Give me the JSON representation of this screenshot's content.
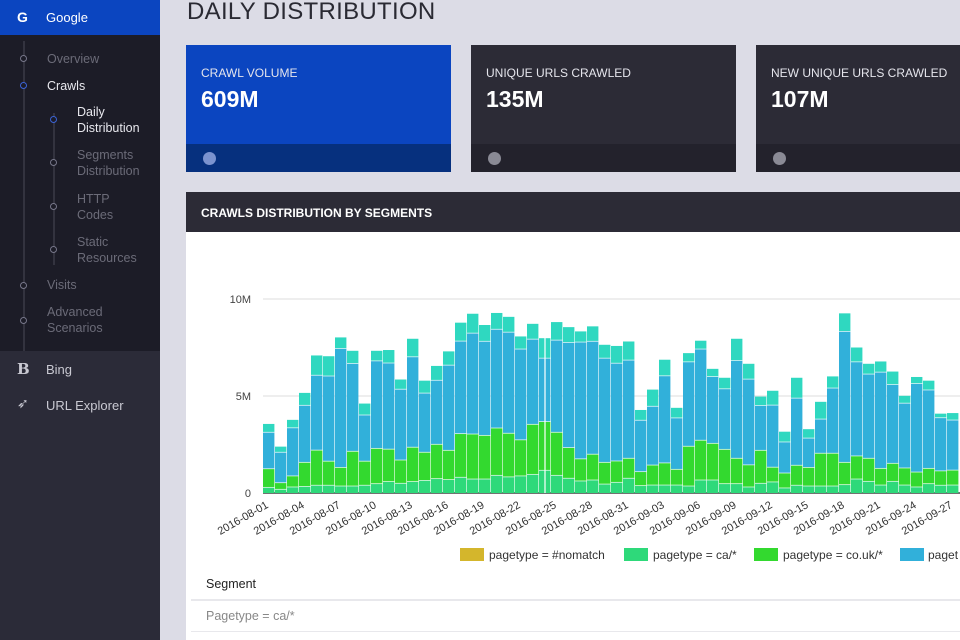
{
  "sidebar": {
    "google": {
      "label": "Google",
      "icon": "google-g-icon"
    },
    "items": [
      {
        "label": "Overview",
        "active": false
      },
      {
        "label": "Crawls",
        "active": true
      },
      {
        "label": "Visits",
        "active": false
      },
      {
        "label": "Advanced Scenarios",
        "active": false
      }
    ],
    "sub_items": [
      {
        "label": "Daily Distribution",
        "active": true
      },
      {
        "label": "Segments Distribution",
        "active": false
      },
      {
        "label": "HTTP Codes",
        "active": false
      },
      {
        "label": "Static Resources",
        "active": false
      }
    ],
    "bing": {
      "label": "Bing",
      "icon": "bing-b-icon"
    },
    "url_explorer": {
      "label": "URL Explorer",
      "icon": "rocket-icon"
    }
  },
  "page_title": "DAILY DISTRIBUTION",
  "cards": [
    {
      "label": "CRAWL VOLUME",
      "value": "609M"
    },
    {
      "label": "UNIQUE URLS CRAWLED",
      "value": "135M"
    },
    {
      "label": "NEW UNIQUE URLS CRAWLED",
      "value": "107M"
    }
  ],
  "panel": {
    "title": "CRAWLS DISTRIBUTION BY SEGMENTS"
  },
  "table": {
    "header": "Segment",
    "rows": [
      "Pagetype = ca/*"
    ]
  },
  "colors": {
    "accent": "#0b45c0",
    "nomatch": "#d4b62c",
    "ca": "#2ed97a",
    "couk": "#33d92f",
    "blue": "#31b0da",
    "teal": "#2fd8c0"
  },
  "chart_data": {
    "type": "bar",
    "stacked": true,
    "ylim": [
      0,
      10000000
    ],
    "yticks": [
      {
        "v": 0,
        "label": "0"
      },
      {
        "v": 5000000,
        "label": "5M"
      },
      {
        "v": 10000000,
        "label": "10M"
      }
    ],
    "grid": true,
    "legend_position": "bottom",
    "start_date": "2016-08-01",
    "xtick_labels": [
      "2016-08-01",
      "2016-08-04",
      "2016-08-07",
      "2016-08-10",
      "2016-08-13",
      "2016-08-16",
      "2016-08-19",
      "2016-08-22",
      "2016-08-25",
      "2016-08-28",
      "2016-08-31",
      "2016-09-03",
      "2016-09-06",
      "2016-09-09",
      "2016-09-12",
      "2016-09-15",
      "2016-09-18",
      "2016-09-21",
      "2016-09-24",
      "2016-09-27"
    ],
    "highlight_date": "2016-08-24",
    "units": "M",
    "legend": [
      {
        "name": "pagetype = #nomatch",
        "color": "#d4b62c"
      },
      {
        "name": "pagetype = ca/*",
        "color": "#2ed97a"
      },
      {
        "name": "pagetype = co.uk/*",
        "color": "#33d92f"
      },
      {
        "name": "paget",
        "color": "#31b0da"
      }
    ],
    "series": [
      {
        "name": "pagetype = ca/*",
        "color": "#2ed97a",
        "values": [
          0.29,
          0.19,
          0.31,
          0.34,
          0.4,
          0.4,
          0.36,
          0.36,
          0.4,
          0.48,
          0.59,
          0.5,
          0.59,
          0.65,
          0.74,
          0.69,
          0.81,
          0.72,
          0.72,
          0.91,
          0.83,
          0.88,
          0.96,
          1.17,
          0.91,
          0.76,
          0.62,
          0.67,
          0.46,
          0.55,
          0.76,
          0.38,
          0.41,
          0.41,
          0.41,
          0.36,
          0.67,
          0.67,
          0.48,
          0.48,
          0.31,
          0.5,
          0.57,
          0.26,
          0.4,
          0.36,
          0.36,
          0.36,
          0.43,
          0.72,
          0.6,
          0.41,
          0.6,
          0.41,
          0.31,
          0.48,
          0.4,
          0.41
        ]
      },
      {
        "name": "pagetype = co.uk/*",
        "color": "#33d92f",
        "values": [
          0.96,
          0.34,
          0.57,
          1.24,
          1.81,
          1.24,
          0.96,
          1.79,
          1.24,
          1.82,
          1.67,
          1.2,
          1.77,
          1.45,
          1.77,
          1.51,
          2.25,
          2.32,
          2.25,
          2.44,
          2.25,
          1.86,
          2.58,
          2.51,
          2.22,
          1.58,
          1.14,
          1.33,
          1.12,
          1.1,
          1.03,
          0.72,
          1.03,
          1.14,
          0.81,
          2.05,
          2.05,
          1.89,
          1.77,
          1.31,
          1.14,
          1.7,
          0.76,
          0.77,
          1.03,
          0.96,
          1.69,
          1.69,
          1.15,
          1.19,
          1.19,
          0.86,
          0.93,
          0.88,
          0.77,
          0.79,
          0.74,
          0.77
        ]
      },
      {
        "name": "paget",
        "color": "#31b0da",
        "values": [
          1.88,
          1.57,
          2.48,
          2.94,
          3.86,
          4.39,
          6.13,
          4.53,
          2.38,
          4.51,
          4.44,
          3.65,
          4.66,
          3.05,
          3.3,
          4.39,
          4.77,
          5.2,
          4.85,
          5.09,
          5.21,
          4.68,
          4.39,
          3.27,
          4.75,
          5.42,
          6.02,
          5.82,
          5.37,
          5.04,
          5.06,
          2.65,
          3.03,
          4.49,
          2.65,
          4.35,
          4.7,
          3.44,
          3.12,
          5.04,
          4.42,
          2.31,
          3.2,
          1.6,
          3.46,
          1.51,
          1.76,
          3.36,
          6.75,
          4.85,
          4.34,
          4.96,
          4.06,
          3.34,
          4.56,
          4.04,
          2.74,
          2.58
        ]
      },
      {
        "color": "#2fd8c0",
        "values": [
          0.43,
          0.29,
          0.41,
          0.64,
          1.02,
          1.02,
          0.57,
          0.65,
          0.59,
          0.52,
          0.67,
          0.5,
          0.93,
          0.64,
          0.74,
          0.71,
          0.95,
          1.0,
          0.84,
          0.84,
          0.79,
          0.65,
          0.79,
          1.03,
          0.93,
          0.79,
          0.55,
          0.77,
          0.69,
          0.89,
          0.96,
          0.53,
          0.86,
          0.83,
          0.52,
          0.45,
          0.43,
          0.4,
          0.57,
          1.12,
          0.79,
          0.46,
          0.74,
          0.53,
          1.05,
          0.46,
          0.89,
          0.6,
          0.93,
          0.74,
          0.53,
          0.55,
          0.67,
          0.38,
          0.34,
          0.48,
          0.21,
          0.36
        ]
      }
    ]
  }
}
